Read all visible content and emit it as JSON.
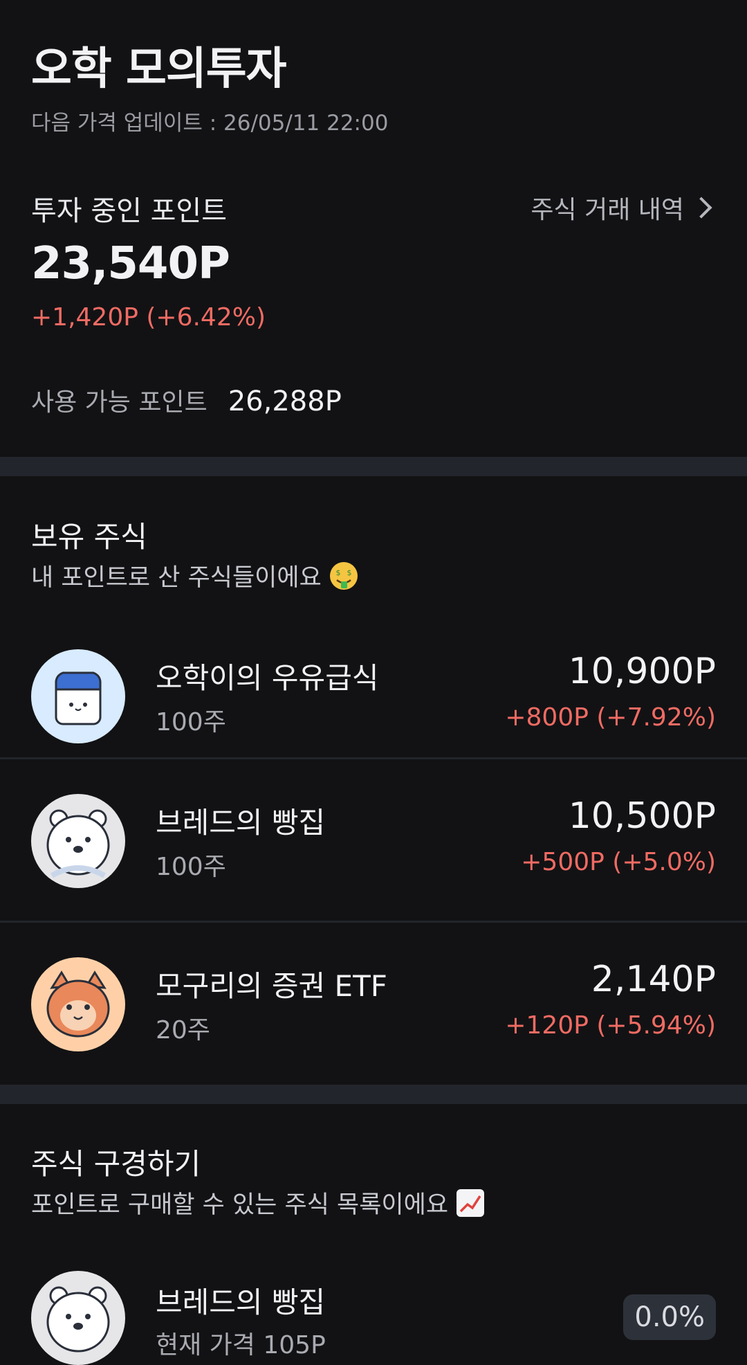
{
  "header": {
    "title": "오학 모의투자",
    "update_text": "다음 가격 업데이트 : 26/05/11 22:00"
  },
  "portfolio": {
    "label": "투자 중인 포인트",
    "history_link": "주식 거래 내역",
    "value": "23,540P",
    "change": "+1,420P (+6.42%)",
    "available_label": "사용 가능 포인트",
    "available_value": "26,288P"
  },
  "holdings": {
    "title": "보유 주식",
    "subtitle": "내 포인트로 산 주식들이에요",
    "items": [
      {
        "name": "오학이의 우유급식",
        "qty": "100주",
        "price": "10,900P",
        "change": "+800P (+7.92%)",
        "icon": "milk-carton-icon"
      },
      {
        "name": "브레드의 빵집",
        "qty": "100주",
        "price": "10,500P",
        "change": "+500P (+5.0%)",
        "icon": "polar-bear-icon"
      },
      {
        "name": "모구리의 증권 ETF",
        "qty": "20주",
        "price": "2,140P",
        "change": "+120P (+5.94%)",
        "icon": "fox-icon"
      }
    ]
  },
  "browse": {
    "title": "주식 구경하기",
    "subtitle": "포인트로 구매할 수 있는 주식 목록이에요",
    "items": [
      {
        "name": "브레드의 빵집",
        "price_text": "현재 가격 105P",
        "percent": "0.0%",
        "icon": "polar-bear-icon"
      }
    ]
  },
  "colors": {
    "background": "#121214",
    "positive": "#f06b63",
    "band": "#23252c"
  }
}
